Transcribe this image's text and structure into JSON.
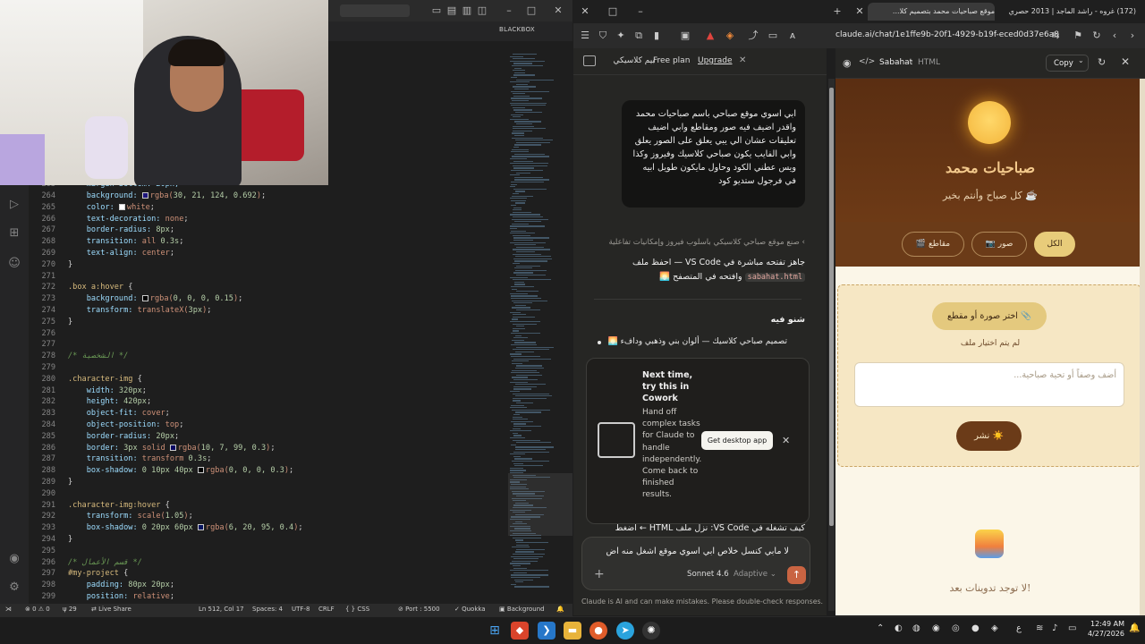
{
  "vscode": {
    "titlebar_extension": "BLACKBOX",
    "code_lines": [
      {
        "n": "264",
        "indent": 1,
        "tokens": [
          [
            "prop",
            "background: "
          ],
          [
            "sw",
            "#1e157c"
          ],
          [
            "val",
            "rgba("
          ],
          [
            "num",
            "30, 21, 124, 0.692"
          ],
          [
            "val",
            ")"
          ],
          [
            "pun",
            ";"
          ]
        ]
      },
      {
        "n": "265",
        "indent": 1,
        "tokens": [
          [
            "prop",
            "color: "
          ],
          [
            "sw",
            "#ffffff"
          ],
          [
            "val",
            "white"
          ],
          [
            "pun",
            ";"
          ]
        ]
      },
      {
        "n": "266",
        "indent": 1,
        "tokens": [
          [
            "prop",
            "text-decoration: "
          ],
          [
            "val",
            "none"
          ],
          [
            "pun",
            ";"
          ]
        ]
      },
      {
        "n": "267",
        "indent": 1,
        "tokens": [
          [
            "prop",
            "border-radius: "
          ],
          [
            "num",
            "8px"
          ],
          [
            "pun",
            ";"
          ]
        ]
      },
      {
        "n": "268",
        "indent": 1,
        "tokens": [
          [
            "prop",
            "transition: "
          ],
          [
            "val",
            "all "
          ],
          [
            "num",
            "0.3s"
          ],
          [
            "pun",
            ";"
          ]
        ]
      },
      {
        "n": "269",
        "indent": 1,
        "tokens": [
          [
            "prop",
            "text-align: "
          ],
          [
            "val",
            "center"
          ],
          [
            "pun",
            ";"
          ]
        ]
      },
      {
        "n": "270",
        "indent": 0,
        "tokens": [
          [
            "pun",
            "}"
          ]
        ]
      },
      {
        "n": "271",
        "indent": 0,
        "tokens": []
      },
      {
        "n": "272",
        "indent": 0,
        "tokens": [
          [
            "sel",
            ".box a:hover "
          ],
          [
            "pun",
            "{"
          ]
        ]
      },
      {
        "n": "273",
        "indent": 1,
        "tokens": [
          [
            "prop",
            "background: "
          ],
          [
            "sw",
            "#000000"
          ],
          [
            "val",
            "rgba("
          ],
          [
            "num",
            "0, 0, 0, 0.15"
          ],
          [
            "val",
            ")"
          ],
          [
            "pun",
            ";"
          ]
        ]
      },
      {
        "n": "274",
        "indent": 1,
        "tokens": [
          [
            "prop",
            "transform: "
          ],
          [
            "val",
            "translateX("
          ],
          [
            "num",
            "3px"
          ],
          [
            "val",
            ")"
          ],
          [
            "pun",
            ";"
          ]
        ]
      },
      {
        "n": "275",
        "indent": 0,
        "tokens": [
          [
            "pun",
            "}"
          ]
        ]
      },
      {
        "n": "276",
        "indent": 0,
        "tokens": []
      },
      {
        "n": "277",
        "indent": 0,
        "tokens": []
      },
      {
        "n": "278",
        "indent": 0,
        "tokens": [
          [
            "cmt",
            "/* الشخصية */"
          ]
        ]
      },
      {
        "n": "279",
        "indent": 0,
        "tokens": []
      },
      {
        "n": "280",
        "indent": 0,
        "tokens": [
          [
            "sel",
            ".character-img "
          ],
          [
            "pun",
            "{"
          ]
        ]
      },
      {
        "n": "281",
        "indent": 1,
        "tokens": [
          [
            "prop",
            "width: "
          ],
          [
            "num",
            "320px"
          ],
          [
            "pun",
            ";"
          ]
        ]
      },
      {
        "n": "282",
        "indent": 1,
        "tokens": [
          [
            "prop",
            "height: "
          ],
          [
            "num",
            "420px"
          ],
          [
            "pun",
            ";"
          ]
        ]
      },
      {
        "n": "283",
        "indent": 1,
        "tokens": [
          [
            "prop",
            "object-fit: "
          ],
          [
            "val",
            "cover"
          ],
          [
            "pun",
            ";"
          ]
        ]
      },
      {
        "n": "284",
        "indent": 1,
        "tokens": [
          [
            "prop",
            "object-position: "
          ],
          [
            "val",
            "top"
          ],
          [
            "pun",
            ";"
          ]
        ]
      },
      {
        "n": "285",
        "indent": 1,
        "tokens": [
          [
            "prop",
            "border-radius: "
          ],
          [
            "num",
            "20px"
          ],
          [
            "pun",
            ";"
          ]
        ]
      },
      {
        "n": "286",
        "indent": 1,
        "tokens": [
          [
            "prop",
            "border: "
          ],
          [
            "num",
            "3px "
          ],
          [
            "val",
            "solid "
          ],
          [
            "sw",
            "#0a0763"
          ],
          [
            "val",
            "rgba("
          ],
          [
            "num",
            "10, 7, 99, 0.3"
          ],
          [
            "val",
            ")"
          ],
          [
            "pun",
            ";"
          ]
        ]
      },
      {
        "n": "287",
        "indent": 1,
        "tokens": [
          [
            "prop",
            "transition: "
          ],
          [
            "val",
            "transform "
          ],
          [
            "num",
            "0.3s"
          ],
          [
            "pun",
            ";"
          ]
        ]
      },
      {
        "n": "288",
        "indent": 1,
        "tokens": [
          [
            "prop",
            "box-shadow: "
          ],
          [
            "num",
            "0 10px 40px "
          ],
          [
            "sw",
            "#000000"
          ],
          [
            "val",
            "rgba("
          ],
          [
            "num",
            "0, 0, 0, 0.3"
          ],
          [
            "val",
            ")"
          ],
          [
            "pun",
            ";"
          ]
        ]
      },
      {
        "n": "289",
        "indent": 0,
        "tokens": [
          [
            "pun",
            "}"
          ]
        ]
      },
      {
        "n": "290",
        "indent": 0,
        "tokens": []
      },
      {
        "n": "291",
        "indent": 0,
        "tokens": [
          [
            "sel",
            ".character-img:hover "
          ],
          [
            "pun",
            "{"
          ]
        ]
      },
      {
        "n": "292",
        "indent": 1,
        "tokens": [
          [
            "prop",
            "transform: "
          ],
          [
            "val",
            "scale("
          ],
          [
            "num",
            "1.05"
          ],
          [
            "val",
            ")"
          ],
          [
            "pun",
            ";"
          ]
        ]
      },
      {
        "n": "293",
        "indent": 1,
        "tokens": [
          [
            "prop",
            "box-shadow: "
          ],
          [
            "num",
            "0 20px 60px "
          ],
          [
            "sw",
            "#06145f"
          ],
          [
            "val",
            "rgba("
          ],
          [
            "num",
            "6, 20, 95, 0.4"
          ],
          [
            "val",
            ")"
          ],
          [
            "pun",
            ";"
          ]
        ]
      },
      {
        "n": "294",
        "indent": 0,
        "tokens": [
          [
            "pun",
            "}"
          ]
        ]
      },
      {
        "n": "295",
        "indent": 0,
        "tokens": []
      },
      {
        "n": "296",
        "indent": 0,
        "tokens": [
          [
            "cmt",
            "/* قسم الأعمال */"
          ]
        ]
      },
      {
        "n": "297",
        "indent": 0,
        "tokens": [
          [
            "id",
            "#my-project "
          ],
          [
            "pun",
            "{"
          ]
        ]
      },
      {
        "n": "298",
        "indent": 1,
        "tokens": [
          [
            "prop",
            "padding: "
          ],
          [
            "num",
            "80px 20px"
          ],
          [
            "pun",
            ";"
          ]
        ]
      },
      {
        "n": "299",
        "indent": 1,
        "tokens": [
          [
            "prop",
            "position: "
          ],
          [
            "val",
            "relative"
          ],
          [
            "pun",
            ";"
          ]
        ]
      }
    ],
    "partial_top_line": {
      "n": "263",
      "text": "margin-bottom: 20px;"
    },
    "status": {
      "problems": "⊗ 0 ⚠ 0",
      "ports_count": "29",
      "live_share": "Live Share",
      "position": "Ln 512, Col 17",
      "spaces": "Spaces: 4",
      "encoding": "UTF-8",
      "eol": "CRLF",
      "language": "CSS",
      "port": "Port : 5500",
      "quokka": "Quokka",
      "background": "Background"
    }
  },
  "browser": {
    "tab_active": "موقع صباحيات محمد بتصميم كلا...",
    "tab_other": "(172) غروه - راشد الماجد | 2013 حصري",
    "url": "claude.ai/chat/1e1ffe9b-20f1-4929-b19f-eced0d37e6a8"
  },
  "chat": {
    "title": "بيم كلاسيكي",
    "free_plan": "Free plan",
    "upgrade": "Upgrade",
    "user_message": "ابي اسوي موقع صباحي باسم صباحيات محمد واقدر اضيف فيه صور ومقاطع وابي اضيف تعليقات عشان الي يبي يعلق على الصور يعلق وابي الفايب يكون صباحي كلاسيك وفيروز وكذا ويس عطني الكود وحاول مايكون طويل ابيه في فرجول ستديو كود",
    "reply_summary": "صنع موقع صباحي كلاسيكي بأسلوب فيروز وإمكانيات تفاعلية",
    "reply_text": "جاهز تفتحه مباشرة في VS Code — احفظ ملف sabahat.html وافتحه في المتصفح 🌅",
    "reply_code": "sabahat.html",
    "features_heading": "شنو فيه",
    "feature_1": "تصميم صباحي كلاسيك — ألوان بني وذهبي ودافء 🌅",
    "reply_tail": "كيف تشغله في VS Code: نزل ملف HTML ← اضغط",
    "composer_text": "لا مابي كنسل خلاص ابي اسوي موقع اشغل منه اض",
    "model": "Sonnet 4.6",
    "mode": "Adaptive",
    "disclaimer": "Claude is AI and can make mistakes. Please double-check responses."
  },
  "cowork": {
    "title": "Next time, try this in Cowork",
    "body": "Hand off complex tasks for Claude to handle independently. Come back to finished results.",
    "button": "Get desktop app"
  },
  "artifact": {
    "name": "Sabahat",
    "separator": "·",
    "type": "HTML",
    "copy": "Copy"
  },
  "site": {
    "title": "صباحيات محمد",
    "subtitle": "كل صباح وأنتم بخير ☕",
    "filters": [
      "الكل",
      "📷 صور",
      "🎬 مقاطع"
    ],
    "choose": "اختر صورة أو مقطع 📎",
    "no_file": "لم يتم اختيار ملف",
    "caption_placeholder": "أضف وصفاً أو تحية صباحية...",
    "post": "نشر ☀️",
    "empty": "لا توجد تدوينات بعد!"
  },
  "taskbar": {
    "time": "12:49 AM",
    "date": "4/27/2026",
    "lang": "ع"
  },
  "colors": {
    "accent_send": "#c96442",
    "site_brown": "#6b3b18",
    "site_gold": "#e4c97e"
  }
}
